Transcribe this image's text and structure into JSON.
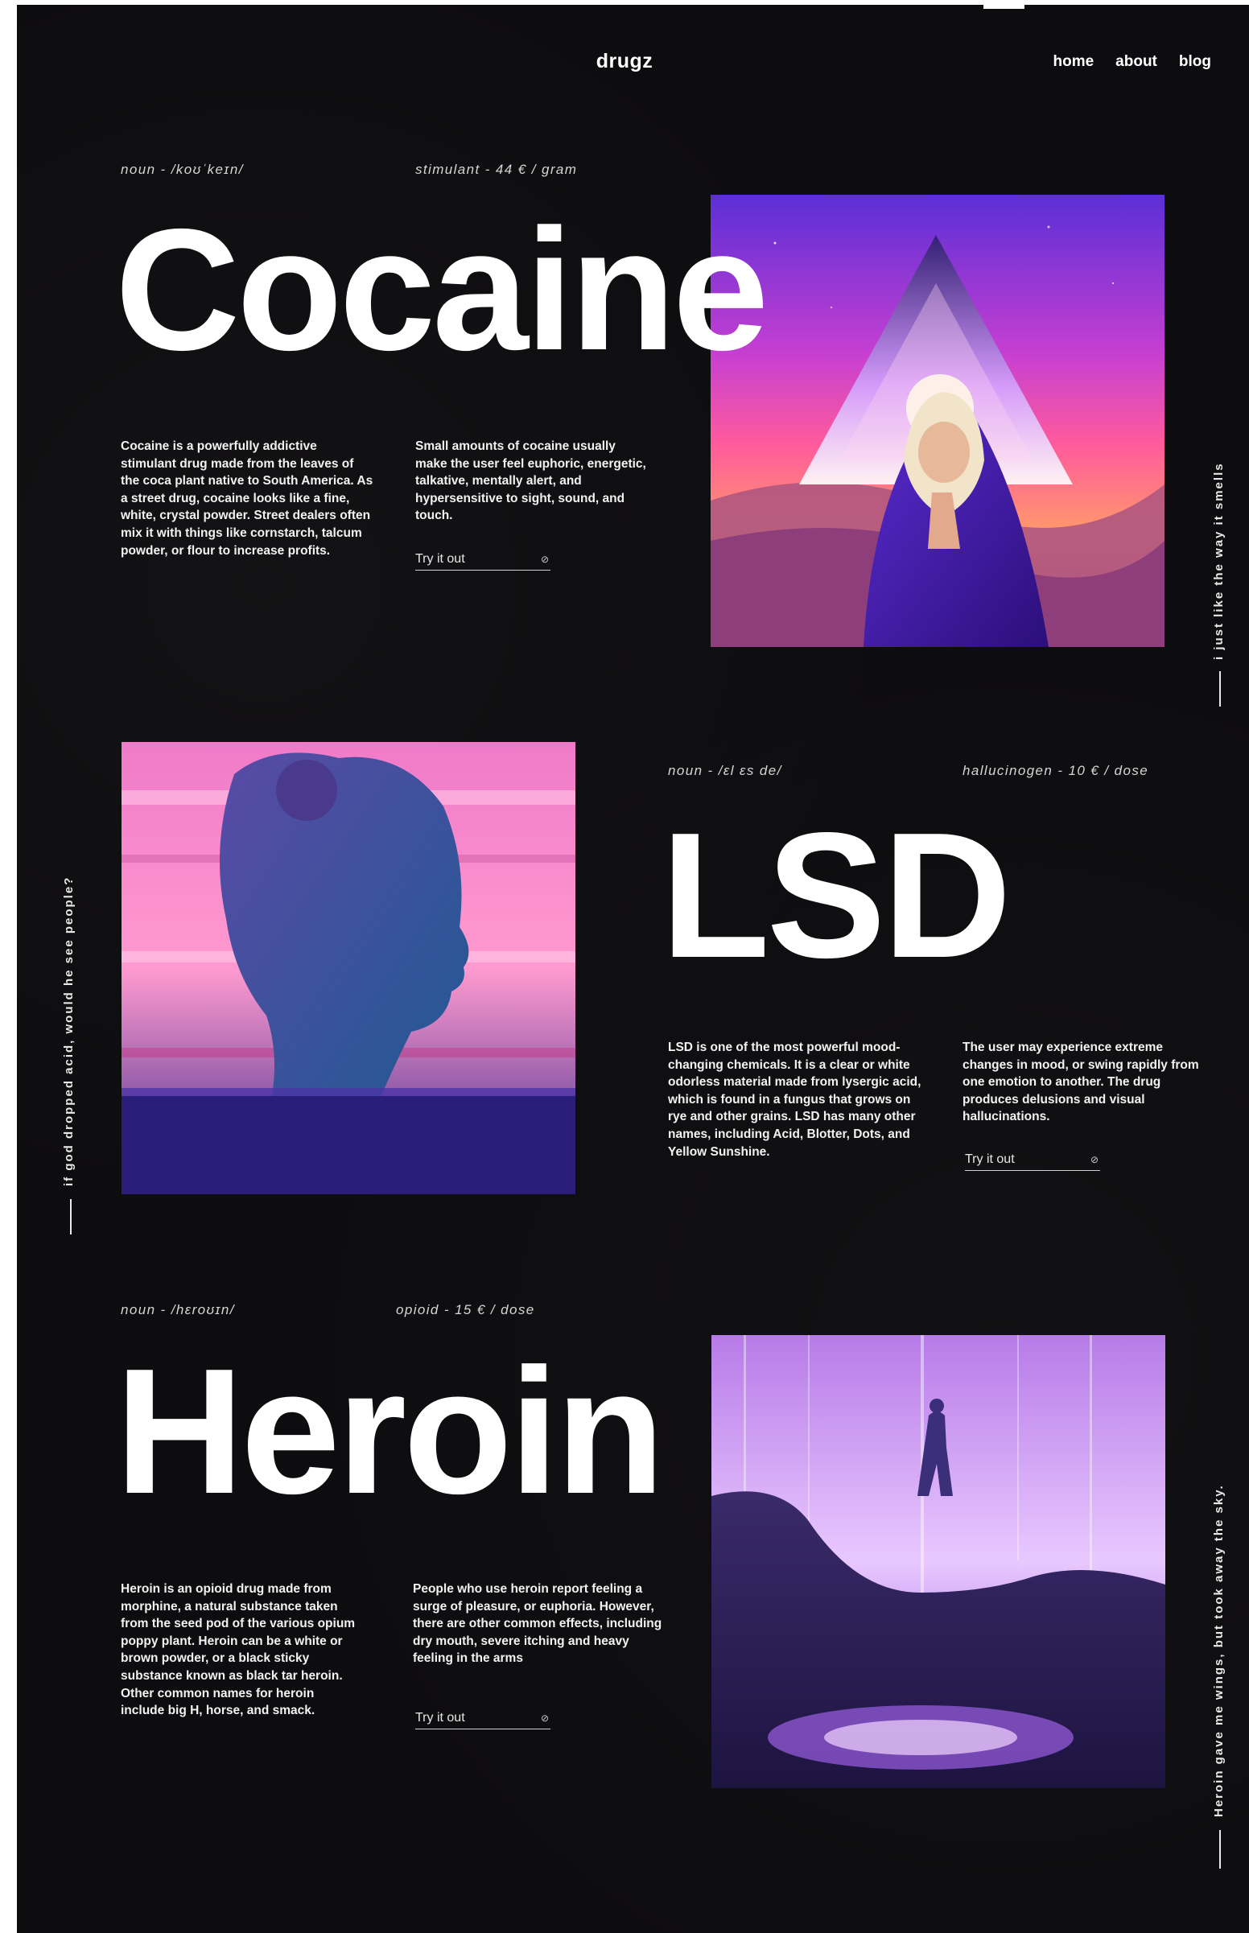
{
  "brand": "drugz",
  "nav": [
    "home",
    "about",
    "blog"
  ],
  "sections": [
    {
      "pronunciation": "noun - /koʊˈkeɪn/",
      "category": "stimulant - 44 € / gram",
      "title": "Cocaine",
      "paragraph1": "Cocaine is a powerfully addictive stimulant drug made from the leaves of the coca plant native to South America. As a street drug, cocaine looks like a fine, white, crystal powder. Street dealers often mix it with things like cornstarch, talcum powder, or flour to increase profits.",
      "paragraph2": "Small amounts of cocaine usually make the user feel euphoric, energetic, talkative, mentally alert, and hypersensitive to sight, sound, and touch.",
      "cta": "Try it out"
    },
    {
      "pronunciation": "noun - /ɛl ɛs de/",
      "category": "hallucinogen - 10 € / dose",
      "title": "LSD",
      "paragraph1": "LSD is one of the most powerful mood-changing chemicals. It is a clear or white odorless material made from lysergic acid, which is found in a fungus that grows on rye and other grains. LSD has many other names, including Acid, Blotter, Dots, and Yellow Sunshine.",
      "paragraph2": "The user may experience extreme changes in mood, or swing rapidly from one emotion to another. The drug produces delusions and visual hallucinations.",
      "cta": "Try it out"
    },
    {
      "pronunciation": "noun - /hɛroʊɪn/",
      "category": "opioid - 15 € / dose",
      "title": "Heroin",
      "paragraph1": "Heroin is an opioid drug made from morphine, a natural substance taken from the seed pod of the various opium poppy plant. Heroin can be a white or brown powder, or a black sticky substance known as black tar heroin. Other common names for heroin include big H, horse, and smack.",
      "paragraph2": "People who use heroin report feeling a surge of pleasure, or euphoria. However, there are other common effects, including dry mouth, severe itching and heavy feeling in the arms",
      "cta": "Try it out"
    }
  ],
  "side_quotes": {
    "right_top": "i just like the way it smells",
    "left_middle": "if god dropped acid, would he see people?",
    "right_bottom": "Heroin gave me wings, but took away the sky."
  },
  "icons": {
    "cta_arrow": "arrow-link-icon"
  }
}
